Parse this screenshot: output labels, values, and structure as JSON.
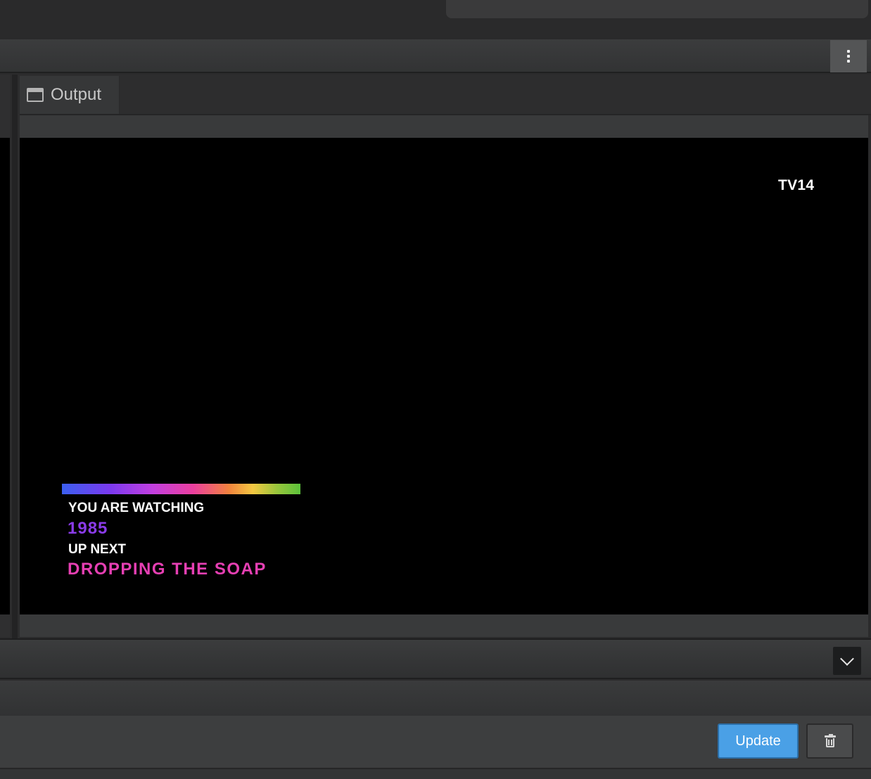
{
  "colors": {
    "accent": "#4aa0e6",
    "watching_title": "#8a3be8",
    "next_title": "#e63fb3",
    "background": "#2b2b2c"
  },
  "output_panel": {
    "tab_label": "Output",
    "tab_icon": "window-icon"
  },
  "preview": {
    "rating": "TV14",
    "watching_label": "YOU ARE WATCHING",
    "watching_title": "1985",
    "next_label": "UP NEXT",
    "next_title": "DROPPING THE SOAP"
  },
  "toolbar": {
    "menu_icon": "kebab-menu-icon"
  },
  "collapse": {
    "icon": "chevron-down-icon"
  },
  "actions": {
    "update_label": "Update",
    "delete_icon": "trash-icon"
  }
}
